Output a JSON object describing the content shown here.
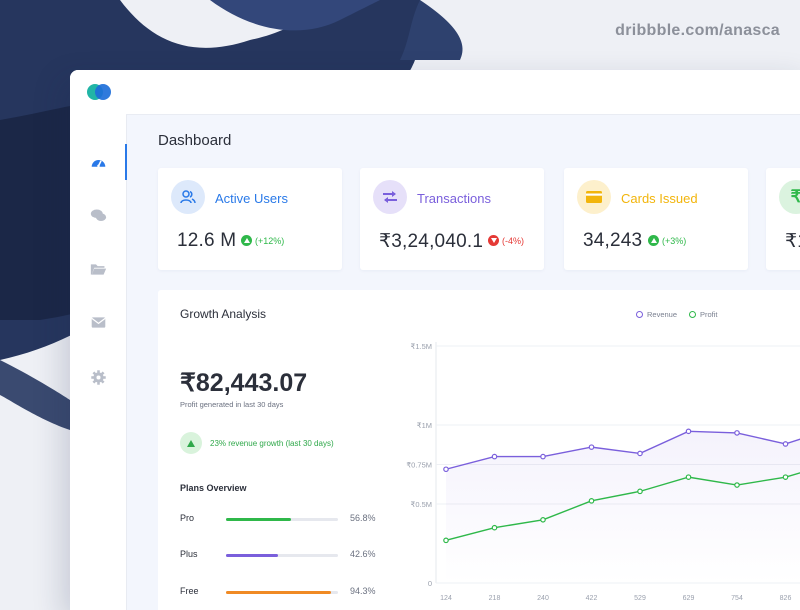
{
  "watermark": "dribbble.com/anasca",
  "page": {
    "title": "Dashboard"
  },
  "sidebar": {
    "items": [
      {
        "icon": "dashboard-icon",
        "active": true
      },
      {
        "icon": "chat-icon",
        "active": false
      },
      {
        "icon": "folder-icon",
        "active": false
      },
      {
        "icon": "mail-icon",
        "active": false
      },
      {
        "icon": "gear-icon",
        "active": false
      }
    ]
  },
  "stats": [
    {
      "label": "Active Users",
      "value": "12.6 M",
      "change": "(+12%)",
      "direction": "up",
      "icon": "users-icon",
      "color": "#2979e8",
      "bg": "#dde9fb"
    },
    {
      "label": "Transactions",
      "value": "₹3,24,040.1",
      "change": "(-4%)",
      "direction": "down",
      "icon": "transfer-icon",
      "color": "#7a5fdc",
      "bg": "#e6e0f9"
    },
    {
      "label": "Cards Issued",
      "value": "34,243",
      "change": "(+3%)",
      "direction": "up",
      "icon": "card-icon",
      "color": "#f2b50c",
      "bg": "#fdf0cc"
    },
    {
      "label": "",
      "value": "₹1",
      "change": "",
      "direction": "",
      "icon": "rupee-icon",
      "color": "#2fb84a",
      "bg": "#dbf3df"
    }
  ],
  "growth": {
    "title": "Growth Analysis",
    "profit_value": "₹82,443.07",
    "profit_caption": "Profit generated in last 30 days",
    "revenue_growth_note": "23% revenue growth (last 30 days)",
    "plans_title": "Plans Overview",
    "plans": [
      {
        "name": "Pro",
        "percent": "56.8%",
        "fill": 0.58,
        "color": "#2fb84a"
      },
      {
        "name": "Plus",
        "percent": "42.6%",
        "fill": 0.46,
        "color": "#7a5fdc"
      },
      {
        "name": "Free",
        "percent": "94.3%",
        "fill": 0.94,
        "color": "#f08a24"
      }
    ]
  },
  "colors": {
    "up": "#2fb84a",
    "down": "#e53935",
    "revenue": "#7a5fdc",
    "profit": "#2fb84a"
  },
  "chart_data": {
    "type": "line",
    "x": [
      "124",
      "218",
      "240",
      "422",
      "529",
      "629",
      "754",
      "826"
    ],
    "y_ticks": [
      "0",
      "₹0.5M",
      "₹0.75M",
      "₹1M",
      "₹1.5M"
    ],
    "ylim": [
      0,
      1.5
    ],
    "series": [
      {
        "name": "Revenue",
        "values": [
          0.72,
          0.8,
          0.8,
          0.86,
          0.82,
          0.96,
          0.95,
          0.88,
          0.98
        ]
      },
      {
        "name": "Profit",
        "values": [
          0.27,
          0.35,
          0.4,
          0.52,
          0.58,
          0.67,
          0.62,
          0.67,
          0.76
        ]
      }
    ],
    "legend_position": "top"
  }
}
